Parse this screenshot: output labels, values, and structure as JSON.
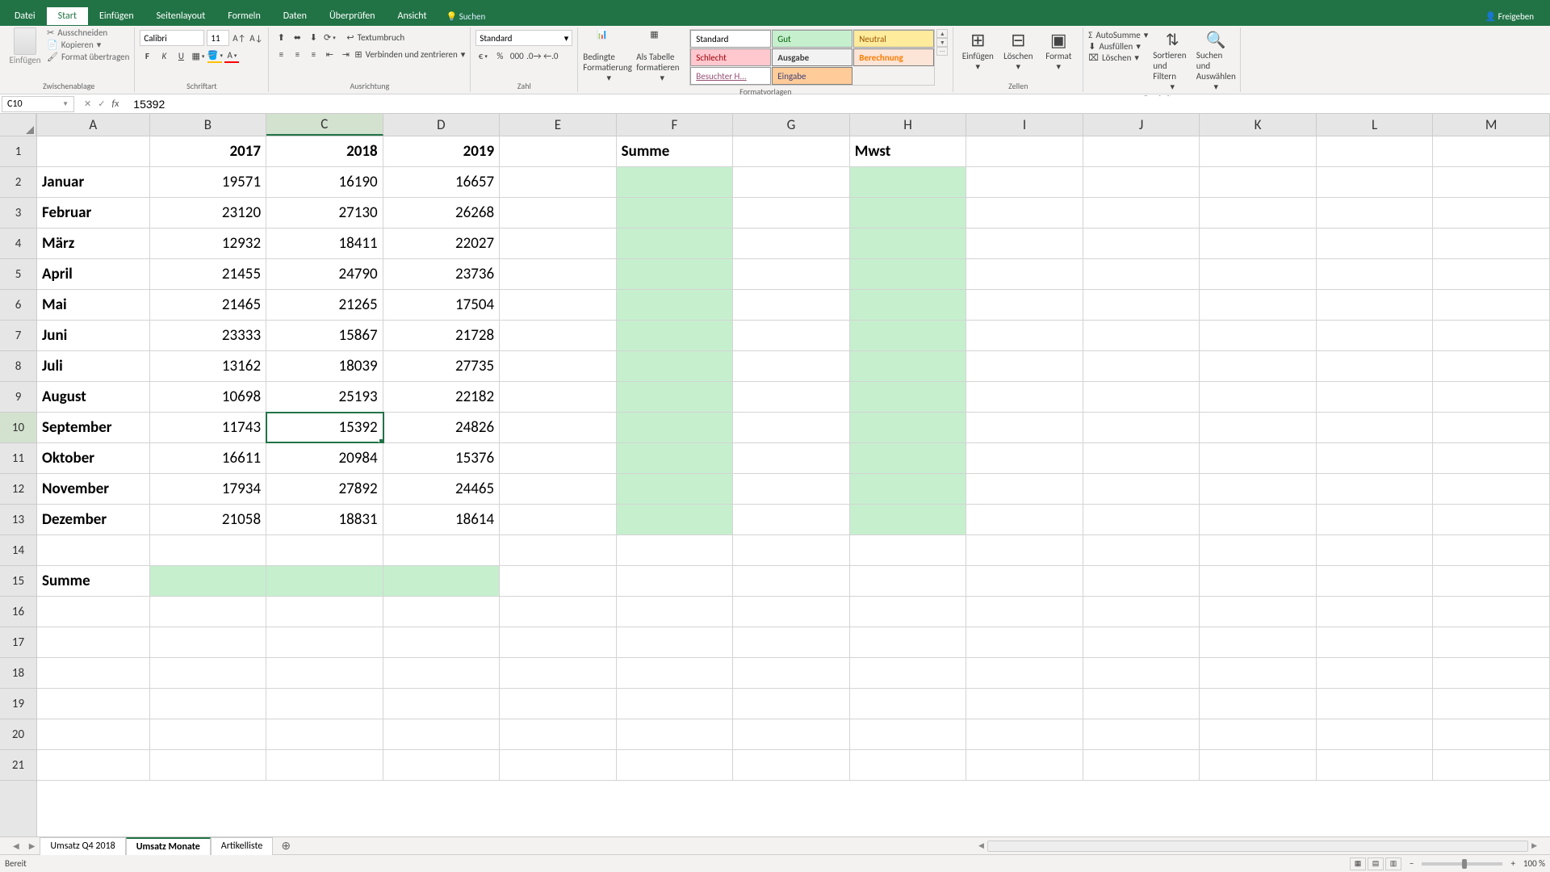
{
  "ribbon": {
    "tabs": [
      "Datei",
      "Start",
      "Einfügen",
      "Seitenlayout",
      "Formeln",
      "Daten",
      "Überprüfen",
      "Ansicht"
    ],
    "search": "Suchen",
    "share": "Freigeben",
    "clipboard": {
      "cut": "Ausschneiden",
      "copy": "Kopieren",
      "format": "Format übertragen",
      "group": "Zwischenablage",
      "paste": "Einfügen"
    },
    "font": {
      "name": "Calibri",
      "size": "11",
      "group": "Schriftart"
    },
    "align": {
      "wrap": "Textumbruch",
      "merge": "Verbinden und zentrieren",
      "group": "Ausrichtung"
    },
    "number": {
      "format": "Standard",
      "group": "Zahl"
    },
    "styles": {
      "cond": "Bedingte Formatierung",
      "table": "Als Tabelle formatieren",
      "group": "Formatvorlagen",
      "items": [
        "Standard",
        "Gut",
        "Neutral",
        "Schlecht",
        "Ausgabe",
        "Berechnung",
        "Besuchter H...",
        "Eingabe"
      ]
    },
    "cells": {
      "insert": "Einfügen",
      "delete": "Löschen",
      "format": "Format",
      "group": "Zellen"
    },
    "editing": {
      "autosum": "AutoSumme",
      "fill": "Ausfüllen",
      "clear": "Löschen",
      "sort": "Sortieren und Filtern",
      "find": "Suchen und Auswählen",
      "group": "Bearbeiten"
    }
  },
  "formula": {
    "ref": "C10",
    "value": "15392"
  },
  "columns": [
    "A",
    "B",
    "C",
    "D",
    "E",
    "F",
    "G",
    "H",
    "I",
    "J",
    "K",
    "L",
    "M"
  ],
  "tableData": {
    "headers": {
      "B": "2017",
      "C": "2018",
      "D": "2019",
      "F": "Summe",
      "H": "Mwst"
    },
    "rows": [
      {
        "A": "Januar",
        "B": "19571",
        "C": "16190",
        "D": "16657"
      },
      {
        "A": "Februar",
        "B": "23120",
        "C": "27130",
        "D": "26268"
      },
      {
        "A": "März",
        "B": "12932",
        "C": "18411",
        "D": "22027"
      },
      {
        "A": "April",
        "B": "21455",
        "C": "24790",
        "D": "23736"
      },
      {
        "A": "Mai",
        "B": "21465",
        "C": "21265",
        "D": "17504"
      },
      {
        "A": "Juni",
        "B": "23333",
        "C": "15867",
        "D": "21728"
      },
      {
        "A": "Juli",
        "B": "13162",
        "C": "18039",
        "D": "27735"
      },
      {
        "A": "August",
        "B": "10698",
        "C": "25193",
        "D": "22182"
      },
      {
        "A": "September",
        "B": "11743",
        "C": "15392",
        "D": "24826"
      },
      {
        "A": "Oktober",
        "B": "16611",
        "C": "20984",
        "D": "15376"
      },
      {
        "A": "November",
        "B": "17934",
        "C": "27892",
        "D": "24465"
      },
      {
        "A": "Dezember",
        "B": "21058",
        "C": "18831",
        "D": "18614"
      }
    ],
    "summaryLabel": "Summe"
  },
  "sheets": {
    "tabs": [
      "Umsatz Q4 2018",
      "Umsatz Monate",
      "Artikelliste"
    ],
    "active": 1
  },
  "status": {
    "ready": "Bereit",
    "zoom": "100 %"
  }
}
